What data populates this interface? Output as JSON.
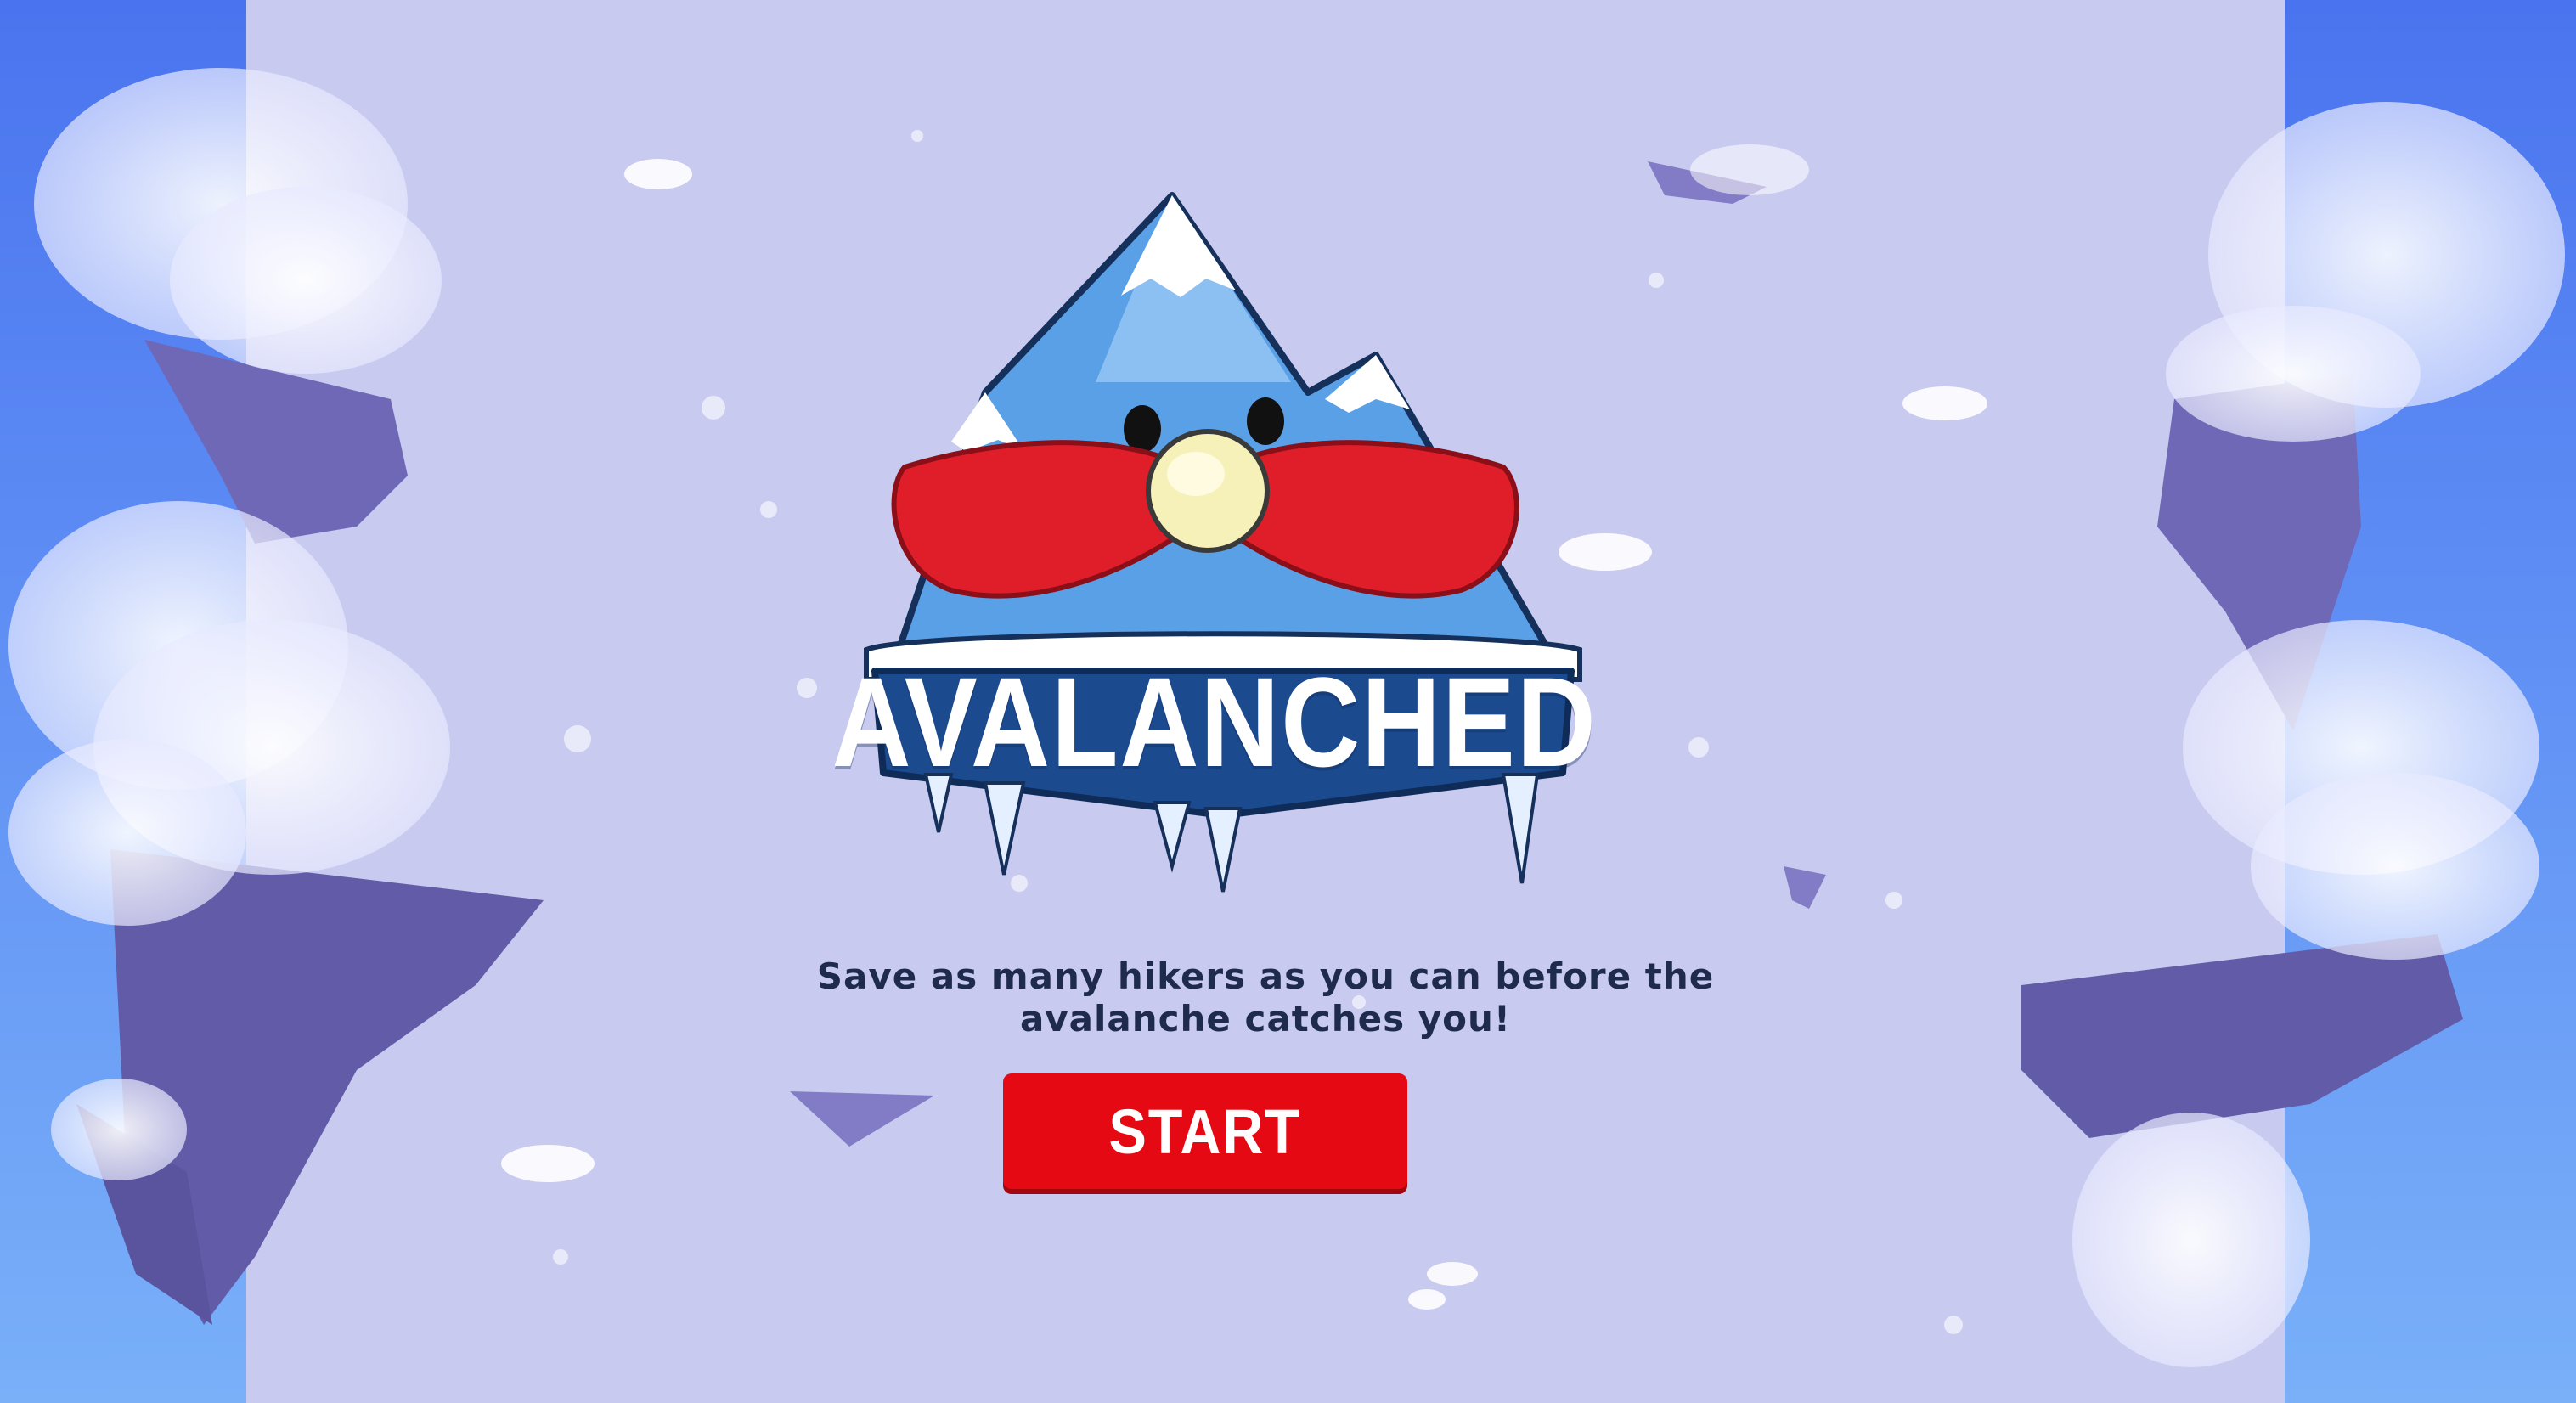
{
  "game": {
    "title": "AVALANCHED",
    "tagline": "Save as many hikers as you can before the avalanche catches you!",
    "start_label": "START"
  },
  "colors": {
    "sky": "#5d8cf4",
    "snowfield": "#c8caef",
    "cliff_shadow": "#6e68b6",
    "mountain": "#5aa0e6",
    "mustache": "#e01e2a",
    "banner": "#1b4a8e",
    "start_button": "#e50914",
    "tagline_text": "#1f2b4d"
  },
  "icons": {
    "logo": "mountain-mascot-icon"
  }
}
